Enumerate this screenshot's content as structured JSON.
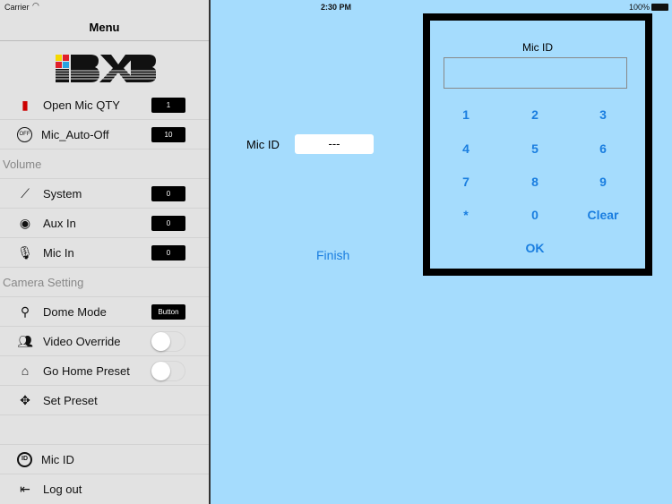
{
  "status": {
    "carrier": "Carrier",
    "time": "2:30 PM",
    "battery": "100%"
  },
  "sidebar": {
    "title": "Menu",
    "logo": "BXB",
    "open_mic": {
      "label": "Open Mic QTY",
      "value": "1",
      "icon": "microphone-icon"
    },
    "auto_off": {
      "label": "Mic_Auto-Off",
      "value": "10",
      "icon": "off-icon"
    },
    "volume_header": "Volume",
    "system": {
      "label": "System",
      "value": "0"
    },
    "aux": {
      "label": "Aux In",
      "value": "0"
    },
    "mic_in": {
      "label": "Mic In",
      "value": "0"
    },
    "camera_header": "Camera Setting",
    "dome": {
      "label": "Dome Mode",
      "value": "Button"
    },
    "video_override": {
      "label": "Video Override",
      "on": false
    },
    "go_home": {
      "label": "Go Home Preset",
      "on": false
    },
    "set_preset": {
      "label": "Set Preset"
    },
    "mic_id": {
      "label": "Mic ID"
    },
    "logout": {
      "label": "Log out"
    }
  },
  "main": {
    "mic_id_label": "Mic ID",
    "mic_id_value": "---",
    "finish": "Finish"
  },
  "keypad": {
    "title": "Mic ID",
    "input_value": "",
    "keys": [
      "1",
      "2",
      "3",
      "4",
      "5",
      "6",
      "7",
      "8",
      "9",
      "*",
      "0",
      "Clear"
    ],
    "ok": "OK",
    "accent": "#1a7ee0"
  }
}
